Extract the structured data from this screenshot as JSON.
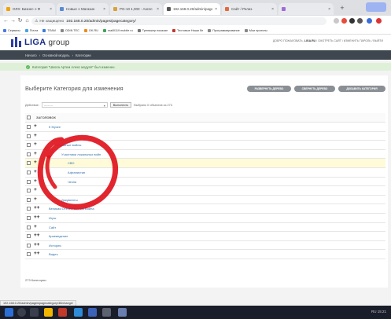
{
  "browser": {
    "tabs": [
      {
        "label": "ОЛХ: Бизнес ≡ Ф",
        "color": "#f0a400"
      },
      {
        "label": "Новые ≡ Магазин",
        "color": "#5a8ad6"
      },
      {
        "label": "PG-10 1,000 - Ангел",
        "color": "#d9a23b"
      },
      {
        "label": "192.168.0.20/admin/page",
        "color": "#555555"
      },
      {
        "label": "Сайт / Релиз",
        "color": "#e36b3a"
      },
      {
        "label": "",
        "color": "#a06bd6"
      }
    ],
    "new_tab": "+",
    "address_prefix": "Не защищено",
    "address_url": "192.168.0.20/admin/pages/pagecategory/",
    "nav": {
      "back": "←",
      "forward": "→",
      "reload": "↻",
      "home": "⌂"
    },
    "bookmarks": [
      {
        "label": "Сервисы",
        "color": "#4a7be0"
      },
      {
        "label": "Почта",
        "color": "#4aa3e0"
      },
      {
        "label": "TEAM",
        "color": "#3b7bd9"
      },
      {
        "label": "ODIN TEC",
        "color": "#888888"
      },
      {
        "label": "OK.RU",
        "color": "#f08a1a"
      },
      {
        "label": "mail0119 mobile ru",
        "color": "#3fa45b"
      },
      {
        "label": "Тренажер показан",
        "color": "#777777"
      },
      {
        "label": "Тестовые Наши бл",
        "color": "#c0392b"
      },
      {
        "label": "Программирование",
        "color": "#888888"
      },
      {
        "label": "Мои проекты",
        "color": "#888888"
      }
    ]
  },
  "site": {
    "brand": "LIGA",
    "brand_suffix": "group",
    "user_links_prefix": "ДОБРО ПОЖАЛОВАТЬ,",
    "user_name": "LIGA.RU",
    "user_links": "/ СМОТРЕТЬ САЙТ / ИЗМЕНИТЬ ПАРОЛЬ / ВЫЙТИ"
  },
  "breadcrumbs": [
    "Начало",
    "›",
    "Основной модуль",
    "›",
    "Категории"
  ],
  "message": "Категория \"Школа Артем Алекс модуля\" был изменен.",
  "page": {
    "title": "Выберите Категория для изменения",
    "tools": [
      "РАЗВЕРНУТЬ ДЕРЕВО",
      "СВЕРНУТЬ ДЕРЕВО",
      "ДОБАВИТЬ КАТЕГОРИЯ"
    ],
    "actions_label": "Действие:",
    "actions_placeholder": "---------",
    "go_button": "Выполнить",
    "selected_counter": "Выбрано 0 объектов из 273",
    "column_header": "ЗАГОЛОВОК",
    "rows": [
      {
        "title": "К Музее",
        "indent": 0,
        "moves": "+",
        "hl": false
      },
      {
        "title": "",
        "indent": 0,
        "moves": "+",
        "hl": false
      },
      {
        "title": "Локальные войны",
        "indent": 1,
        "moves": "+",
        "hl": false
      },
      {
        "title": "Участники локальных войн",
        "indent": 2,
        "moves": "+",
        "hl": false
      },
      {
        "title": "СВО",
        "indent": 3,
        "moves": "+",
        "hl": true
      },
      {
        "title": "Афганистан",
        "indent": 3,
        "moves": "+",
        "hl": false
      },
      {
        "title": "Чечня",
        "indent": 3,
        "moves": "+",
        "hl": false
      },
      {
        "title": "",
        "indent": 1,
        "moves": "+",
        "hl": false
      },
      {
        "title": "Документы",
        "indent": 2,
        "moves": "+",
        "hl": false
      },
      {
        "title": "Великая Отечественная Война",
        "indent": 0,
        "moves": "++",
        "hl": false
      },
      {
        "title": "Игры",
        "indent": 0,
        "moves": "++",
        "hl": false
      },
      {
        "title": "Сайт",
        "indent": 0,
        "moves": "+",
        "hl": false
      },
      {
        "title": "Краеведение",
        "indent": 0,
        "moves": "++",
        "hl": false
      },
      {
        "title": "История",
        "indent": 0,
        "moves": "++",
        "hl": false
      },
      {
        "title": "Видео",
        "indent": 0,
        "moves": "++",
        "hl": false
      }
    ],
    "footer_count": "273 Категории"
  },
  "status_url": "192.168.0.20/admin/pages/pagecategory/38/change/",
  "tray": "RU 15:21"
}
